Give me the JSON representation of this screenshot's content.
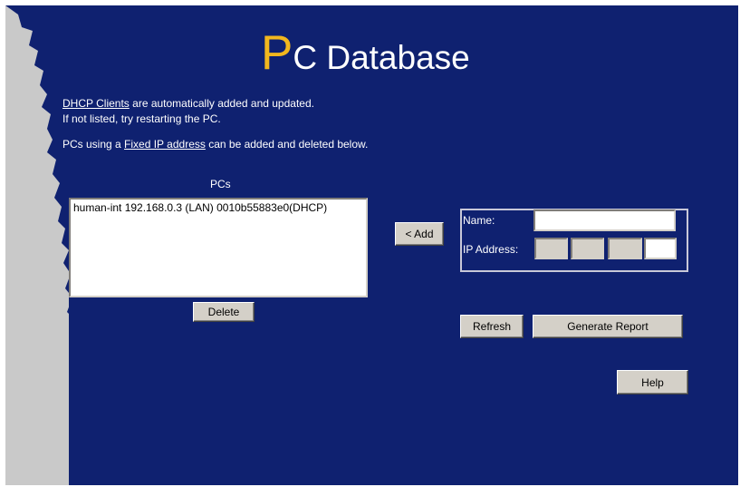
{
  "header": {
    "title_initial": "P",
    "title_rest": "C Database"
  },
  "intro": {
    "dhcp_link": "DHCP Clients",
    "dhcp_text": " are automatically added and updated.",
    "restart_text": "If not listed, try restarting the PC.",
    "fixed_prefix": "PCs using a ",
    "fixed_link": "Fixed IP address",
    "fixed_suffix": " can be added and deleted below."
  },
  "pcs": {
    "label": "PCs",
    "items": [
      "human-int 192.168.0.3 (LAN) 0010b55883e0(DHCP)"
    ],
    "delete_label": "Delete"
  },
  "add_button": "< Add",
  "form": {
    "name_label": "Name:",
    "name_value": "",
    "ip_label": "IP Address:",
    "ip_octets": [
      "",
      "",
      "",
      ""
    ]
  },
  "actions": {
    "refresh": "Refresh",
    "report": "Generate Report",
    "help": "Help"
  },
  "colors": {
    "panel": "#0f2170",
    "coast": "#c9c9c9",
    "accent": "#f2b71e"
  }
}
